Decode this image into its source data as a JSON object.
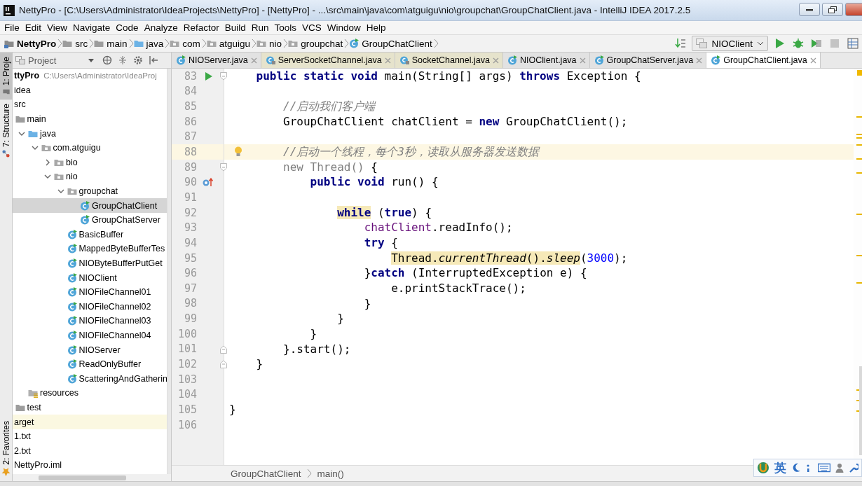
{
  "window": {
    "title": "NettyPro - [C:\\Users\\Administrator\\IdeaProjects\\NettyPro] - [NettyPro] - ...\\src\\main\\java\\com\\atguigu\\nio\\groupchat\\GroupChatClient.java - IntelliJ IDEA 2017.2.5"
  },
  "menu": [
    "File",
    "Edit",
    "View",
    "Navigate",
    "Code",
    "Analyze",
    "Refactor",
    "Build",
    "Run",
    "Tools",
    "VCS",
    "Window",
    "Help"
  ],
  "navigation_bar": [
    {
      "label": "NettyPro",
      "kind": "module"
    },
    {
      "label": "src",
      "kind": "folder"
    },
    {
      "label": "main",
      "kind": "folder"
    },
    {
      "label": "java",
      "kind": "source_folder"
    },
    {
      "label": "com",
      "kind": "package"
    },
    {
      "label": "atguigu",
      "kind": "package"
    },
    {
      "label": "nio",
      "kind": "package"
    },
    {
      "label": "groupchat",
      "kind": "package"
    },
    {
      "label": "GroupChatClient",
      "kind": "class"
    }
  ],
  "run_configuration": {
    "label": "NIOClient"
  },
  "tool_window_strip": [
    {
      "label": "1: Proje",
      "selected": true,
      "kind": "project"
    },
    {
      "label": "7: Structure",
      "selected": false,
      "kind": "structure"
    },
    {
      "label": "2: Favorites",
      "selected": false,
      "kind": "favorites"
    }
  ],
  "project_panel": {
    "title": "Project"
  },
  "project_tree": {
    "label": "ttyPro",
    "path": "C:\\Users\\Administrator\\IdeaProj",
    "selected": false,
    "excluded": false,
    "children": [
      {
        "label": "idea",
        "selected": false,
        "excluded": false
      },
      {
        "label": "src",
        "selected": false,
        "excluded": false,
        "children": [
          {
            "label": "main",
            "kind": "folder",
            "selected": false,
            "excluded": false,
            "children": [
              {
                "label": "java",
                "kind": "source_folder",
                "expanded": true,
                "selected": false,
                "excluded": false,
                "children": [
                  {
                    "label": "com.atguigu",
                    "kind": "package",
                    "expanded": true,
                    "selected": false,
                    "excluded": false,
                    "children": [
                      {
                        "label": "bio",
                        "kind": "package",
                        "expanded": false,
                        "selected": false,
                        "excluded": false
                      },
                      {
                        "label": "nio",
                        "kind": "package",
                        "expanded": true,
                        "selected": false,
                        "excluded": false,
                        "children": [
                          {
                            "label": "groupchat",
                            "kind": "package",
                            "expanded": true,
                            "selected": false,
                            "excluded": false,
                            "children": [
                              {
                                "label": "GroupChatClient",
                                "kind": "class",
                                "selected": true,
                                "excluded": false
                              },
                              {
                                "label": "GroupChatServer",
                                "kind": "class",
                                "selected": false,
                                "excluded": false
                              }
                            ]
                          },
                          {
                            "label": "BasicBuffer",
                            "kind": "class",
                            "selected": false,
                            "excluded": false
                          },
                          {
                            "label": "MappedByteBufferTes",
                            "kind": "class",
                            "selected": false,
                            "excluded": false
                          },
                          {
                            "label": "NIOByteBufferPutGet",
                            "kind": "class",
                            "selected": false,
                            "excluded": false
                          },
                          {
                            "label": "NIOClient",
                            "kind": "class",
                            "selected": false,
                            "excluded": false
                          },
                          {
                            "label": "NIOFileChannel01",
                            "kind": "class",
                            "selected": false,
                            "excluded": false
                          },
                          {
                            "label": "NIOFileChannel02",
                            "kind": "class",
                            "selected": false,
                            "excluded": false
                          },
                          {
                            "label": "NIOFileChannel03",
                            "kind": "class",
                            "selected": false,
                            "excluded": false
                          },
                          {
                            "label": "NIOFileChannel04",
                            "kind": "class",
                            "selected": false,
                            "excluded": false
                          },
                          {
                            "label": "NIOServer",
                            "kind": "class",
                            "selected": false,
                            "excluded": false
                          },
                          {
                            "label": "ReadOnlyBuffer",
                            "kind": "class",
                            "selected": false,
                            "excluded": false
                          },
                          {
                            "label": "ScatteringAndGatherin",
                            "kind": "class",
                            "selected": false,
                            "excluded": false
                          }
                        ]
                      }
                    ]
                  }
                ]
              },
              {
                "label": "resources",
                "kind": "resources_folder",
                "selected": false,
                "excluded": false
              }
            ]
          },
          {
            "label": "test",
            "kind": "folder",
            "selected": false,
            "excluded": false
          }
        ]
      },
      {
        "label": "arget",
        "selected": false,
        "excluded": true
      },
      {
        "label": "1.txt",
        "selected": false,
        "excluded": false
      },
      {
        "label": "2.txt",
        "selected": false,
        "excluded": false
      },
      {
        "label": "NettyPro.iml",
        "selected": false,
        "excluded": false
      }
    ]
  },
  "editor_tabs": [
    {
      "label": "NIOServer.java",
      "kind": "project",
      "selected": false
    },
    {
      "label": "ServerSocketChannel.java",
      "kind": "library",
      "selected": false
    },
    {
      "label": "SocketChannel.java",
      "kind": "library",
      "selected": false
    },
    {
      "label": "NIOClient.java",
      "kind": "project",
      "selected": false
    },
    {
      "label": "GroupChatServer.java",
      "kind": "project",
      "selected": false
    },
    {
      "label": "GroupChatClient.java",
      "kind": "project",
      "selected": true
    }
  ],
  "editor": {
    "lines": [
      {
        "number": "83",
        "current": false,
        "gutter_icons": [
          {
            "kind": "run"
          },
          {
            "kind": "fold"
          }
        ],
        "tokens": [
          {
            "text": "    public static void",
            "kind": "keyword"
          },
          {
            "text": " main(String[] args) ",
            "kind": "plain"
          },
          {
            "text": "throws",
            "kind": "keyword"
          },
          {
            "text": " Exception {",
            "kind": "plain"
          }
        ]
      },
      {
        "number": "84",
        "current": false
      },
      {
        "number": "85",
        "current": false,
        "tokens": [
          {
            "text": "        //启动我们客户端",
            "kind": "comment"
          }
        ]
      },
      {
        "number": "86",
        "current": false,
        "tokens": [
          {
            "text": "        GroupChatClient chatClient = ",
            "kind": "plain"
          },
          {
            "text": "new",
            "kind": "keyword"
          },
          {
            "text": " GroupChatClient();",
            "kind": "plain"
          }
        ]
      },
      {
        "number": "87",
        "current": false
      },
      {
        "number": "88",
        "current": true,
        "gutter_icons": [
          {
            "kind": "bulb"
          }
        ],
        "tokens": [
          {
            "text": "        //启动一个线程，每个3秒，读取从服务器发送数据",
            "kind": "comment"
          }
        ]
      },
      {
        "number": "89",
        "current": false,
        "gutter_icons": [
          {
            "kind": "fold"
          }
        ],
        "tokens": [
          {
            "text": "        new Thread()",
            "kind": "muted"
          },
          {
            "text": " {",
            "kind": "plain"
          }
        ]
      },
      {
        "number": "90",
        "current": false,
        "gutter_icons": [
          {
            "kind": "override"
          }
        ],
        "tokens": [
          {
            "text": "            public void",
            "kind": "keyword"
          },
          {
            "text": " run() {",
            "kind": "plain"
          }
        ]
      },
      {
        "number": "91",
        "current": false
      },
      {
        "number": "92",
        "current": false,
        "tokens": [
          {
            "text": "                while",
            "kind": "keyword",
            "highlight": true
          },
          {
            "text": " (",
            "kind": "plain"
          },
          {
            "text": "true",
            "kind": "keyword"
          },
          {
            "text": ") {",
            "kind": "plain"
          }
        ]
      },
      {
        "number": "93",
        "current": false,
        "tokens": [
          {
            "text": "                    chatClient",
            "kind": "field"
          },
          {
            "text": ".readInfo();",
            "kind": "plain"
          }
        ]
      },
      {
        "number": "94",
        "current": false,
        "tokens": [
          {
            "text": "                    try",
            "kind": "keyword"
          },
          {
            "text": " {",
            "kind": "plain"
          }
        ]
      },
      {
        "number": "95",
        "current": false,
        "tokens": [
          {
            "text": "                        Thread.",
            "kind": "plain",
            "highlight": true
          },
          {
            "text": "currentThread",
            "kind": "static",
            "highlight": true
          },
          {
            "text": "().",
            "kind": "plain",
            "highlight": true
          },
          {
            "text": "sleep",
            "kind": "static",
            "highlight": true
          },
          {
            "text": "(",
            "kind": "plain"
          },
          {
            "text": "3000",
            "kind": "number"
          },
          {
            "text": ");",
            "kind": "plain"
          }
        ]
      },
      {
        "number": "96",
        "current": false,
        "tokens": [
          {
            "text": "                    }",
            "kind": "plain"
          },
          {
            "text": "catch",
            "kind": "keyword"
          },
          {
            "text": " (InterruptedException e) {",
            "kind": "plain"
          }
        ]
      },
      {
        "number": "97",
        "current": false,
        "tokens": [
          {
            "text": "                        e.printStackTrace();",
            "kind": "plain"
          }
        ]
      },
      {
        "number": "98",
        "current": false,
        "tokens": [
          {
            "text": "                    }",
            "kind": "plain"
          }
        ]
      },
      {
        "number": "99",
        "current": false,
        "tokens": [
          {
            "text": "                }",
            "kind": "plain"
          }
        ]
      },
      {
        "number": "100",
        "current": false,
        "tokens": [
          {
            "text": "            }",
            "kind": "plain"
          }
        ]
      },
      {
        "number": "101",
        "current": false,
        "gutter_icons": [
          {
            "kind": "fold_end"
          }
        ],
        "tokens": [
          {
            "text": "        }.start();",
            "kind": "plain"
          }
        ]
      },
      {
        "number": "102",
        "current": false,
        "gutter_icons": [
          {
            "kind": "fold_end"
          }
        ],
        "tokens": [
          {
            "text": "    }",
            "kind": "plain"
          }
        ]
      },
      {
        "number": "103",
        "current": false
      },
      {
        "number": "104",
        "current": false
      },
      {
        "number": "105",
        "current": false,
        "tokens": [
          {
            "text": "}",
            "kind": "plain"
          }
        ]
      },
      {
        "number": "106",
        "current": false
      }
    ]
  },
  "editor_breadcrumbs": [
    "GroupChatClient",
    "main()"
  ],
  "input_method_bar": {
    "label": "英"
  }
}
